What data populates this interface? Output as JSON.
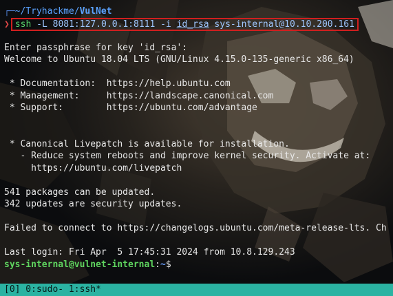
{
  "prompt": {
    "corner": "┌─",
    "path_prefix": "~/Tryhackme/",
    "dir": "VulNet",
    "arrow": "❯"
  },
  "command": {
    "name": "ssh",
    "args": " -L 8081:127.0.0.1:8111 -i ",
    "keyfile": "id_rsa",
    "target": " sys-internal@10.10.200.161"
  },
  "output_lines": [
    "Enter passphrase for key 'id_rsa':",
    "Welcome to Ubuntu 18.04 LTS (GNU/Linux 4.15.0-135-generic x86_64)",
    "",
    " * Documentation:  https://help.ubuntu.com",
    " * Management:     https://landscape.canonical.com",
    " * Support:        https://ubuntu.com/advantage",
    "",
    "",
    " * Canonical Livepatch is available for installation.",
    "   - Reduce system reboots and improve kernel security. Activate at:",
    "     https://ubuntu.com/livepatch",
    "",
    "541 packages can be updated.",
    "342 updates are security updates.",
    "",
    "Failed to connect to https://changelogs.ubuntu.com/meta-release-lts. Ch",
    "",
    "Last login: Fri Apr  5 17:45:31 2024 from 10.8.129.243"
  ],
  "final_prompt": {
    "user_host": "sys-internal@vulnet-internal",
    "sep": ":",
    "path": "~",
    "symbol": "$"
  },
  "status_bar": {
    "session": "[0]",
    "windows": " 0:sudo- 1:ssh*"
  },
  "colors": {
    "status_bar_bg": "#2bb3a2",
    "command_box_border": "#d11f1f",
    "user_green": "#5fd45f",
    "path_blue": "#6aa0ff"
  }
}
